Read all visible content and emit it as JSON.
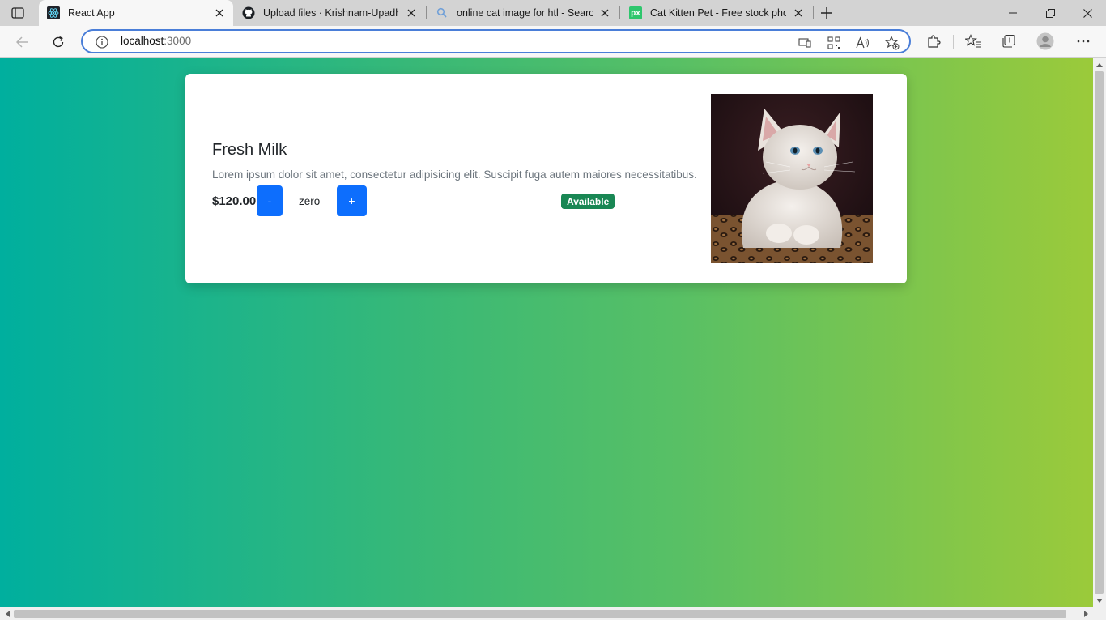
{
  "browser": {
    "tabs": [
      {
        "title": "React App",
        "icon": "react-icon",
        "active": true
      },
      {
        "title": "Upload files · Krishnam-Upadhyay",
        "icon": "github-icon",
        "active": false
      },
      {
        "title": "online cat image for htl - Search",
        "icon": "search-icon",
        "active": false
      },
      {
        "title": "Cat Kitten Pet - Free stock photo",
        "icon": "pixabay-icon",
        "active": false
      }
    ],
    "address": {
      "host": "localhost",
      "port": ":3000"
    },
    "pixabay_glyph": "px",
    "accent_color": "#4a7ed8"
  },
  "product": {
    "title": "Fresh Milk",
    "description": "Lorem ipsum dolor sit amet, consectetur adipisicing elit. Suscipit fuga autem maiores necessitatibus.",
    "price": "$120.00",
    "decrement_label": "-",
    "increment_label": "+",
    "quantity_text": "zero",
    "status_badge": "Available",
    "image_alt": "Cat Kitten Pet",
    "colors": {
      "primary_button": "#0d6efd",
      "badge": "#198754",
      "gradient_start": "#00af9e",
      "gradient_end": "#9bca3a"
    }
  }
}
